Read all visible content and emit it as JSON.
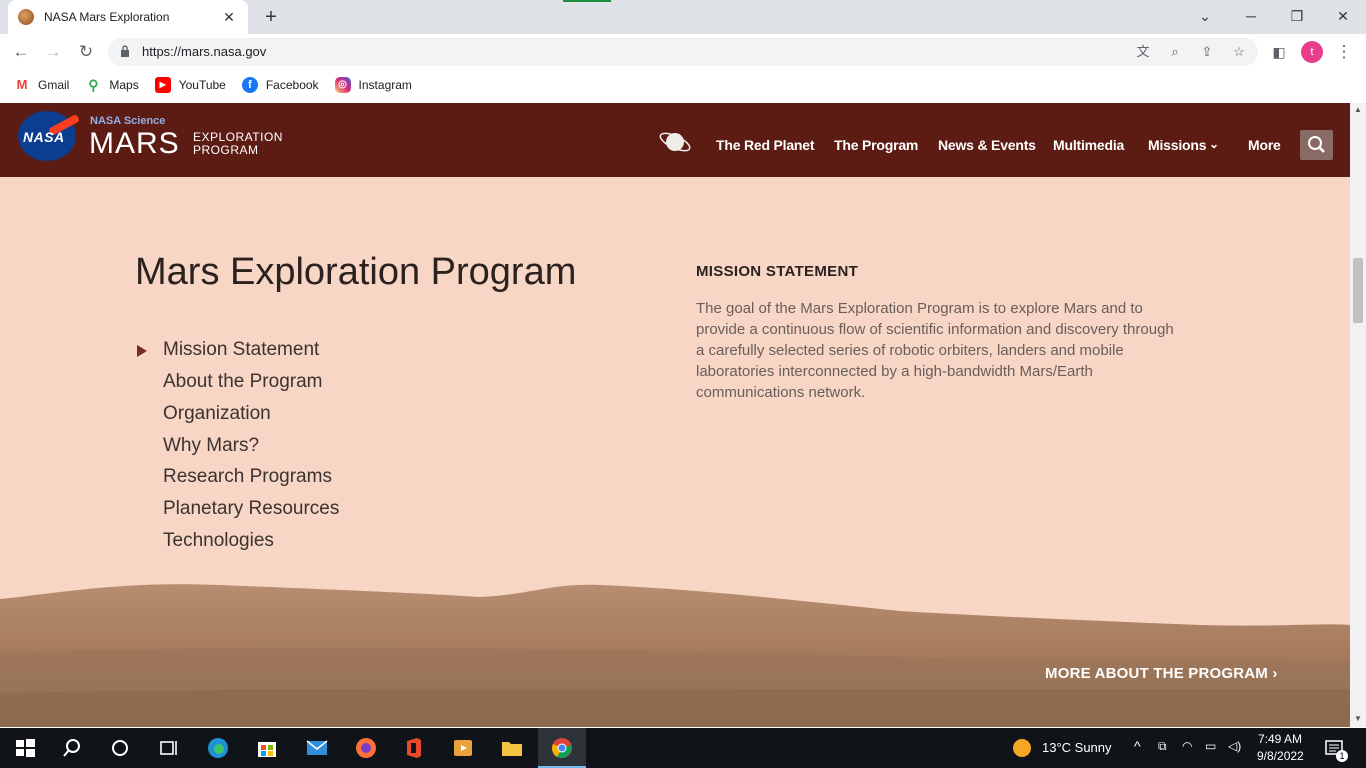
{
  "browser": {
    "tab_title": "NASA Mars Exploration",
    "url": "https://mars.nasa.gov",
    "profile_initial": "t",
    "bookmarks": [
      {
        "label": "Gmail",
        "icon": "gmail-icon"
      },
      {
        "label": "Maps",
        "icon": "maps-icon"
      },
      {
        "label": "YouTube",
        "icon": "youtube-icon"
      },
      {
        "label": "Facebook",
        "icon": "facebook-icon"
      },
      {
        "label": "Instagram",
        "icon": "instagram-icon"
      }
    ]
  },
  "site": {
    "brand": {
      "science": "NASA Science",
      "mars": "MARS",
      "exploration": "EXPLORATION",
      "program": "PROGRAM",
      "logo_text": "NASA"
    },
    "nav": [
      "The Red Planet",
      "The Program",
      "News & Events",
      "Multimedia",
      "Missions",
      "More"
    ],
    "colors": {
      "header": "#5c1c14",
      "page_bg": "#f7d6c6",
      "accent_arrow": "#7a2a1e"
    }
  },
  "content": {
    "heading": "Mars Exploration Program",
    "menu": [
      "Mission Statement",
      "About the Program",
      "Organization",
      "Why Mars?",
      "Research Programs",
      "Planetary Resources",
      "Technologies"
    ],
    "active_menu_item": "Mission Statement",
    "section_title": "MISSION STATEMENT",
    "section_body": "The goal of the Mars Exploration Program is to explore Mars and to provide a continuous flow of scientific information and discovery through a carefully selected series of robotic orbiters, landers and mobile laboratories interconnected by a high-bandwidth Mars/Earth communications network.",
    "more_link": "MORE ABOUT THE PROGRAM ›"
  },
  "taskbar": {
    "weather": "13°C  Sunny",
    "time": "7:49 AM",
    "date": "9/8/2022",
    "notification_count": "1"
  }
}
